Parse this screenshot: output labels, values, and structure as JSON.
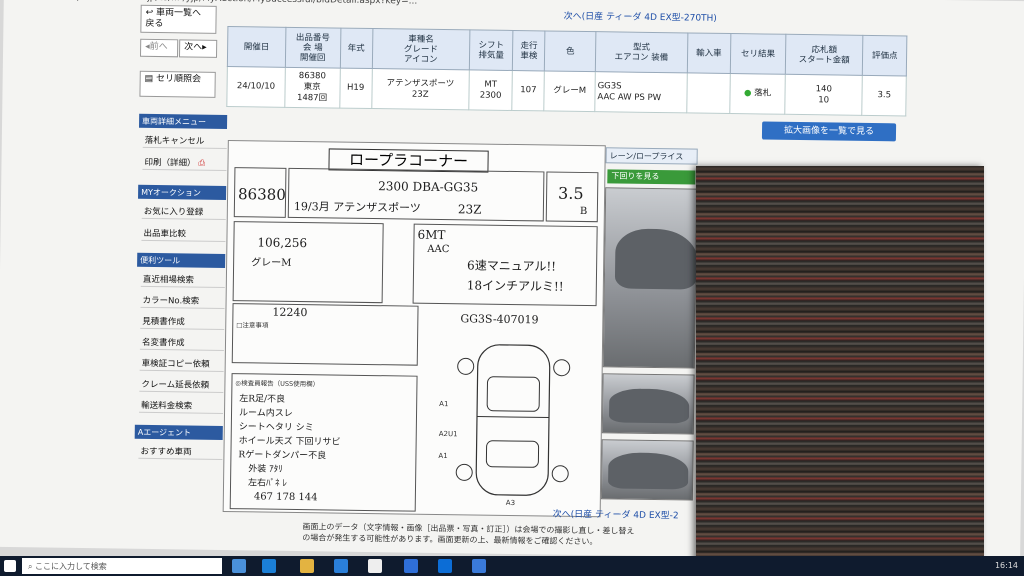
{
  "browser": {
    "url": "https://ssl.cu0200.jp/cs/... /yjp/MyAuction/MySuccessful/bidDetail.aspx?key=..."
  },
  "sidebar": {
    "back_to_list": "車両一覧へ\n戻る",
    "prev": "前へ",
    "next": "次へ",
    "auction_order": "セリ順照会",
    "menu_header": "車両詳細メニュー",
    "items": [
      "落札キャンセル",
      "印刷（詳細）"
    ],
    "my_header": "MYオークション",
    "my_items": [
      "お気に入り登録",
      "出品車比較"
    ],
    "tools_header": "便利ツール",
    "tool_items": [
      "直近相場検索",
      "カラーNo.検索",
      "見積書作成",
      "名変書作成",
      "車検証コピー依頼",
      "クレーム延長依頼",
      "輸送料金検索"
    ],
    "agent_header": "Aエージェント",
    "agent_item": "おすすめ車両"
  },
  "top_nav": {
    "next_link": "次へ(日産 ティーダ  4D EX型-270TH)"
  },
  "info_table": {
    "headers": [
      "開催日",
      "出品番号\n会 場\n開催回",
      "年式",
      "車種名\nグレード\nアイコン",
      "シフト\n排気量",
      "走行\n車検",
      "色",
      "型式\nエアコン 装備",
      "輸入車",
      "セリ結果",
      "応札額\nスタート金額",
      "評価点"
    ],
    "row": [
      "24/10/10",
      "86380\n東京\n1487回",
      "H19",
      "アテンザスポーツ\n23Z",
      "MT\n2300",
      "107",
      "グレーM",
      "GG3S\nAAC AW PS PW",
      "",
      "落札",
      "140\n10",
      "3.5"
    ]
  },
  "enlarge_button": "拡大画像を一覧で見る",
  "sheet": {
    "title": "ロープラコーナー",
    "lot": "86380",
    "model_code": "2300  DBA-GG35",
    "year_model": "19/3月 アテンザスポーツ",
    "grade": "23Z",
    "score": "3.5",
    "interior": "B",
    "mileage": "106,256",
    "color": "グレーM",
    "shift": "6MT",
    "ac": "AAC",
    "notes": [
      "6速マニュアル!!",
      "18インチアルミ!!"
    ],
    "recycle": "12240",
    "chassis": "GG3S-407019",
    "inspection_label": "◎検査員報告（USS使用欄）",
    "report_lines": [
      "左R足/不良",
      "ルーム内スレ",
      "シートヘタリ シミ",
      "ホイール天ズ 下回リサビ",
      "Rゲートダンパー不良",
      "外装 ｱﾀﾘ",
      "左右ﾊﾟﾈ ﾚ"
    ],
    "dims": "467  178  144",
    "note_label": "□注意事項"
  },
  "photos_label": "レーン/ロープライス",
  "photos_button": "下回りを見る",
  "bottom_nav": {
    "next_link": "次へ(日産 ティーダ  4D EX型-2"
  },
  "notice": "画面上のデータ（文字情報・画像［出品票・写真・訂正］）は会場での撮影し直し・差し替え\nの場合が発生する可能性があります。画面更新の上、最新情報をご確認ください。",
  "taskbar": {
    "search_placeholder": "ここに入力して検索",
    "time": "16:14"
  }
}
